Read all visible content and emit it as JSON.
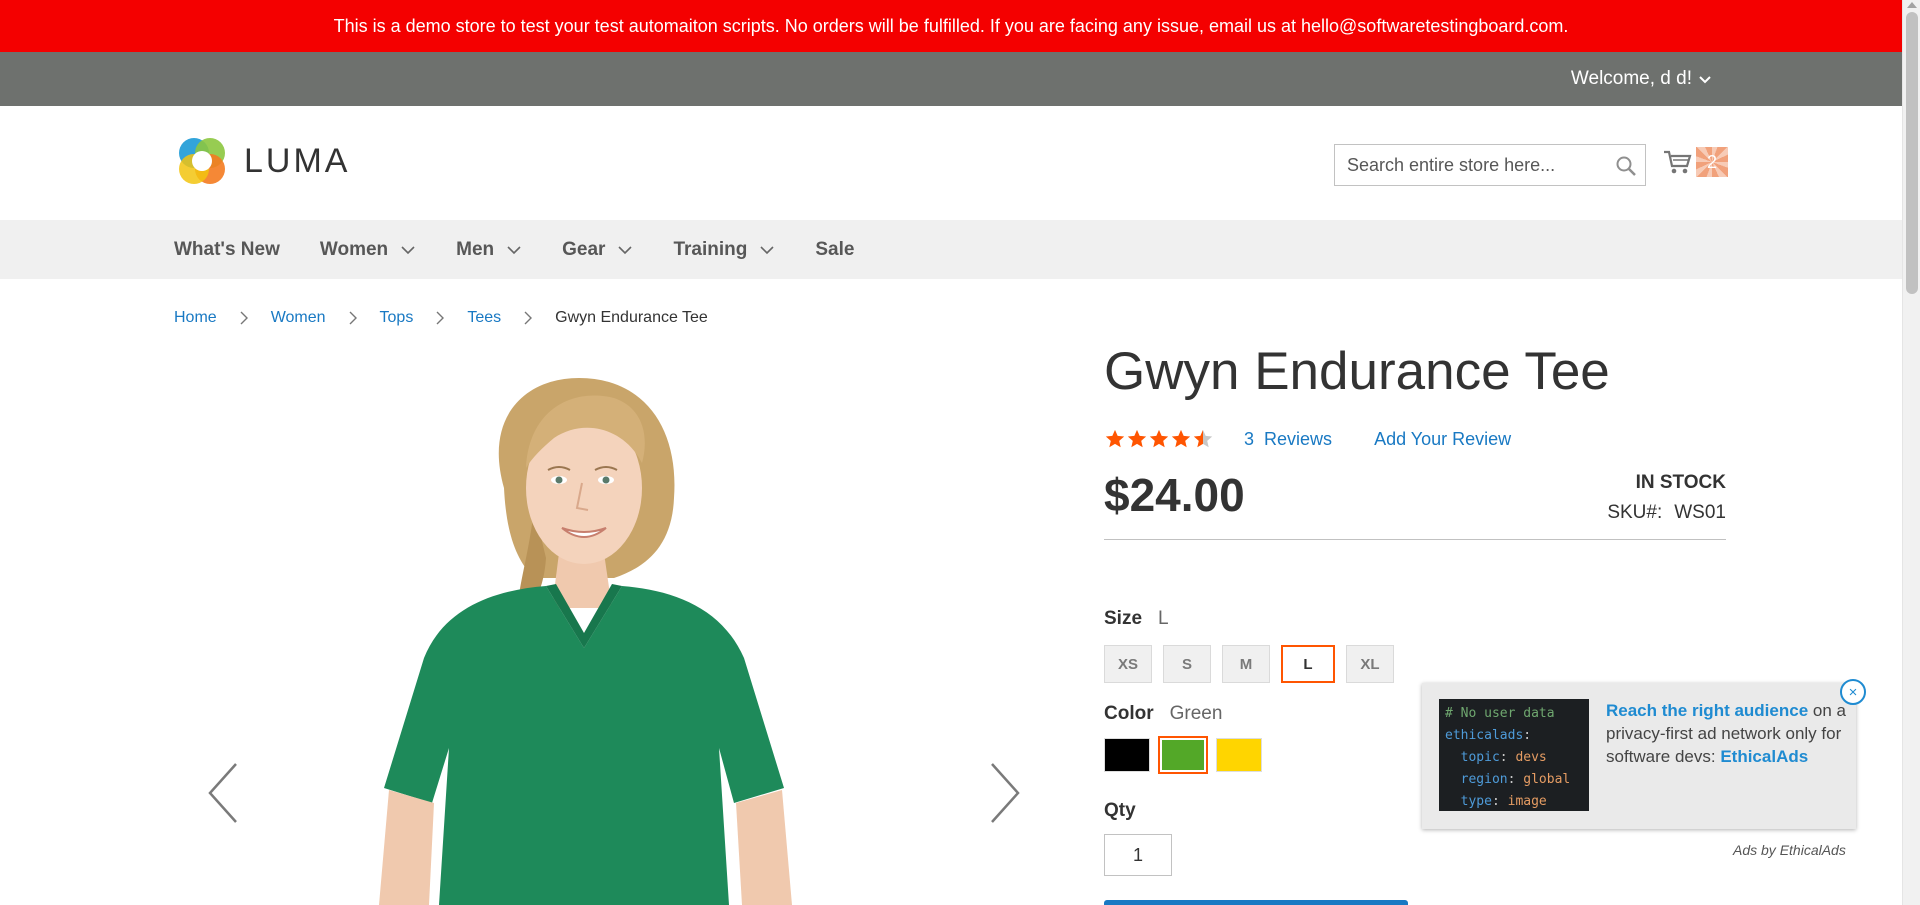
{
  "notice": {
    "text": "This is a demo store to test your test automaiton scripts. No orders will be fulfilled. If you are facing any issue, email us at hello@softwaretestingboard.com."
  },
  "header": {
    "welcome": "Welcome, d d!",
    "logo_text": "LUMA",
    "search_placeholder": "Search entire store here...",
    "cart_count": "2",
    "icons": [
      "chevron-down-icon",
      "luma-logo-icon",
      "search-icon",
      "cart-icon"
    ]
  },
  "nav": {
    "items": [
      {
        "label": "What's New",
        "has_dropdown": false
      },
      {
        "label": "Women",
        "has_dropdown": true
      },
      {
        "label": "Men",
        "has_dropdown": true
      },
      {
        "label": "Gear",
        "has_dropdown": true
      },
      {
        "label": "Training",
        "has_dropdown": true
      },
      {
        "label": "Sale",
        "has_dropdown": false
      }
    ]
  },
  "breadcrumbs": [
    "Home",
    "Women",
    "Tops",
    "Tees",
    "Gwyn Endurance Tee"
  ],
  "product": {
    "title": "Gwyn Endurance Tee",
    "rating": 4.5,
    "rating_max": 5,
    "reviews_count": "3",
    "reviews_label": "Reviews",
    "add_review": "Add Your Review",
    "price": "$24.00",
    "stock": "In stock",
    "sku_label": "SKU#:",
    "sku": "WS01",
    "size": {
      "label": "Size",
      "selected": "L",
      "options": [
        "XS",
        "S",
        "M",
        "L",
        "XL"
      ]
    },
    "color": {
      "label": "Color",
      "selected": "Green",
      "swatches": [
        {
          "name": "Black",
          "hex": "#000000"
        },
        {
          "name": "Green",
          "hex": "#53a828"
        },
        {
          "name": "Yellow",
          "hex": "#ffd500"
        }
      ]
    },
    "qty": {
      "label": "Qty",
      "value": "1"
    }
  },
  "ad": {
    "code": [
      {
        "line": "# No user data",
        "kind": "comment"
      },
      {
        "key": "ethicalads",
        "value": "",
        "indent": false
      },
      {
        "key": "topic",
        "value": "devs",
        "indent": true
      },
      {
        "key": "region",
        "value": "global",
        "indent": true
      },
      {
        "key": "type",
        "value": "image",
        "indent": true
      }
    ],
    "headline": "Reach the right audience",
    "body": " on a privacy-first ad network only for software devs: ",
    "brand": "EthicalAds",
    "close": "×",
    "by": "Ads by EthicalAds"
  },
  "colors": {
    "notice_bg": "#f40000",
    "topbar_bg": "#6e716e",
    "nav_bg": "#f0f0f0",
    "link": "#1979c3",
    "accent": "#ff5501",
    "star": "#ff5501",
    "shirt": "#1e8a5a"
  }
}
